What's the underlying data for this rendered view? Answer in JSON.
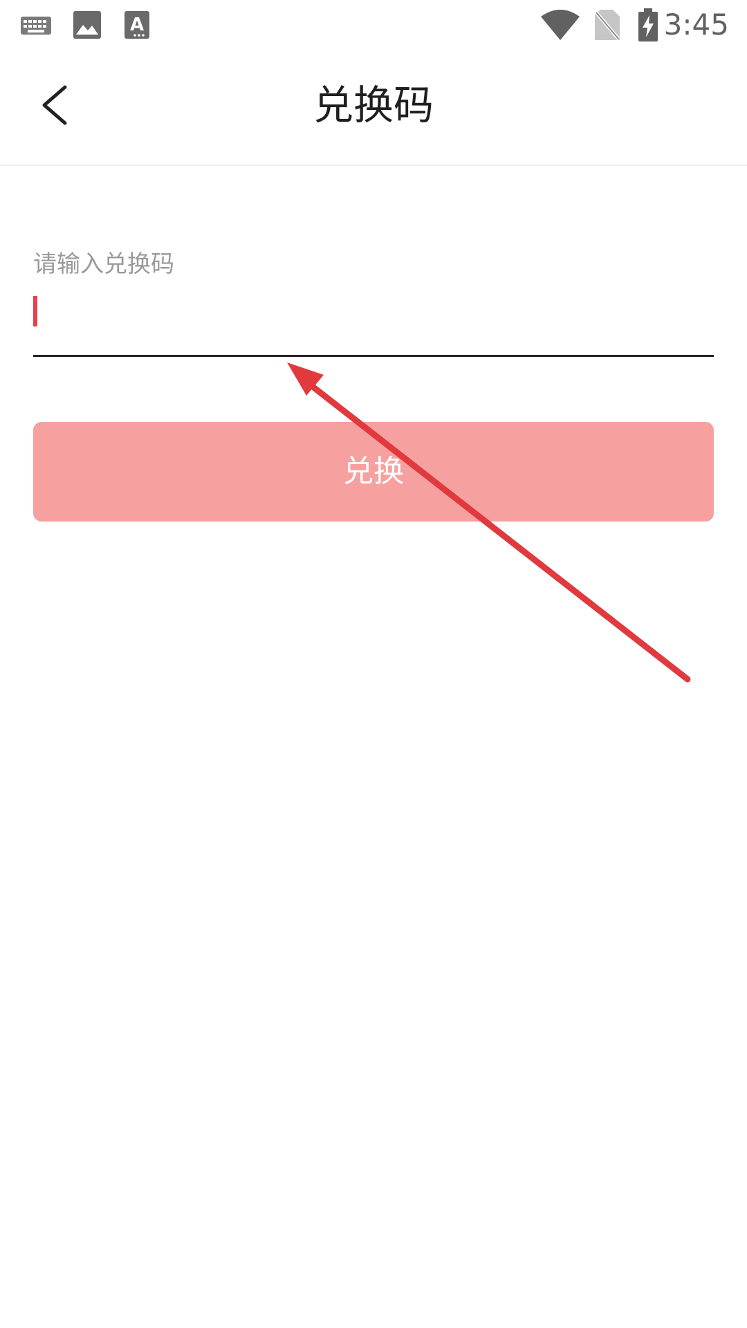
{
  "status_bar": {
    "time": "3:45",
    "icons": [
      "keyboard-icon",
      "image-icon",
      "text-a-icon",
      "wifi-icon",
      "no-sim-icon",
      "battery-charging-icon"
    ]
  },
  "app_bar": {
    "title": "兑换码",
    "back_icon": "chevron-left-icon"
  },
  "form": {
    "label": "请输入兑换码",
    "input_value": "",
    "button_label": "兑换"
  },
  "colors": {
    "accent": "#e8414b",
    "button": "#f6a1a0",
    "annotation_arrow": "#e0393e"
  }
}
